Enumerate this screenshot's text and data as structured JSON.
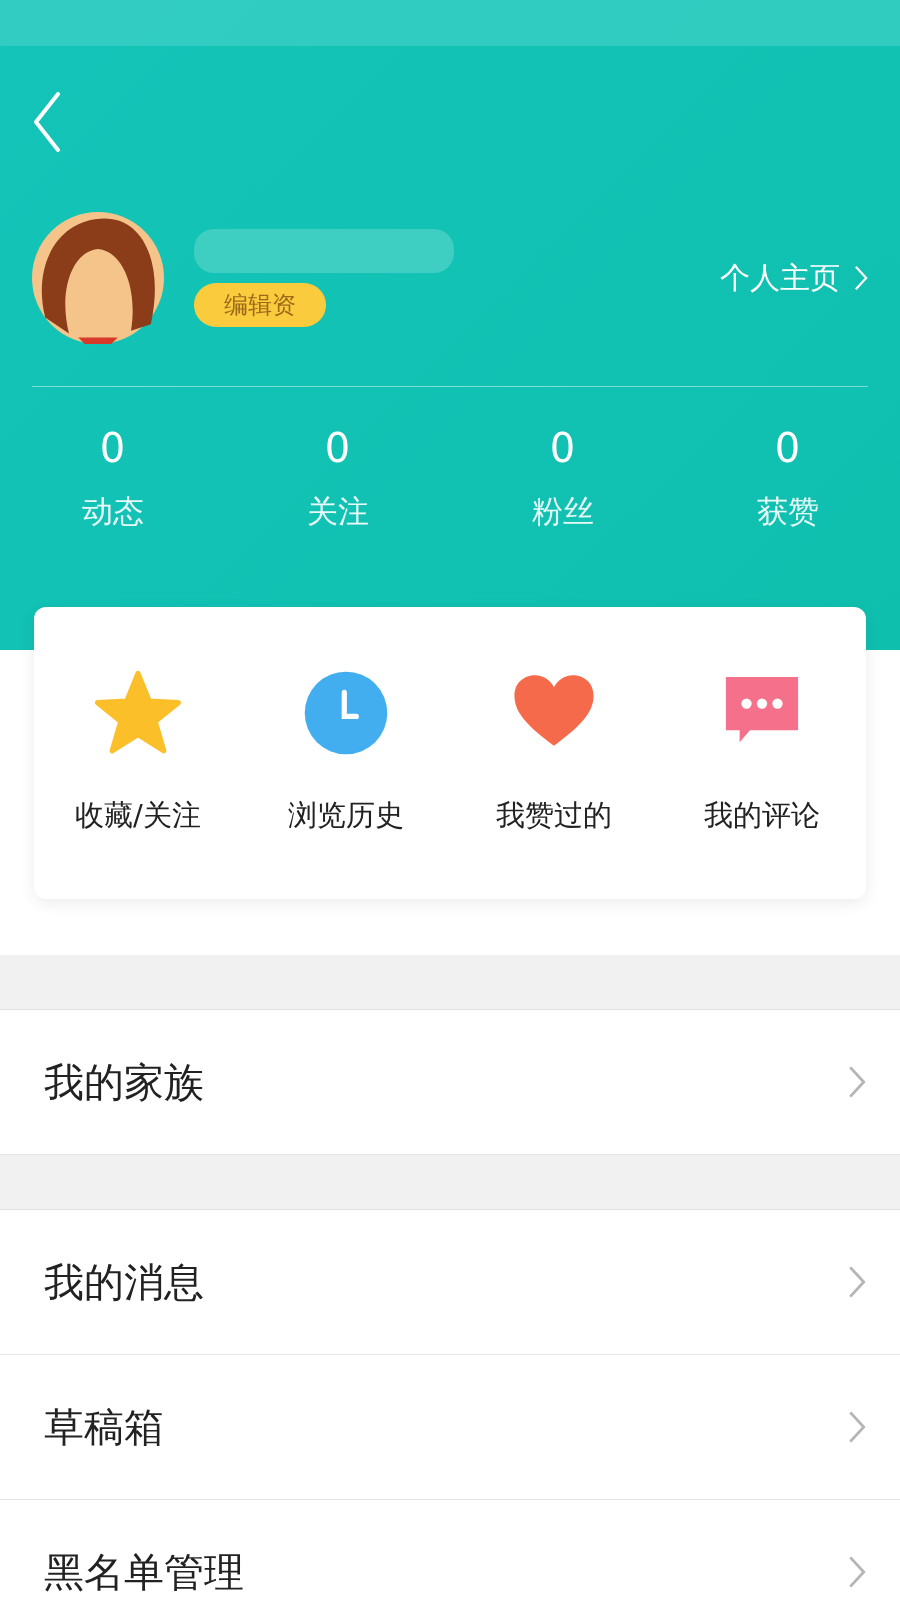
{
  "header": {
    "edit_profile": "编辑资",
    "homepage_link": "个人主页"
  },
  "stats": [
    {
      "value": "0",
      "label": "动态"
    },
    {
      "value": "0",
      "label": "关注"
    },
    {
      "value": "0",
      "label": "粉丝"
    },
    {
      "value": "0",
      "label": "获赞"
    }
  ],
  "shortcuts": [
    {
      "kind": "star",
      "label": "收藏/关注"
    },
    {
      "kind": "clock",
      "label": "浏览历史"
    },
    {
      "kind": "heart",
      "label": "我赞过的"
    },
    {
      "kind": "comment",
      "label": "我的评论"
    }
  ],
  "menu_groups": [
    [
      {
        "label": "我的家族"
      }
    ],
    [
      {
        "label": "我的消息"
      },
      {
        "label": "草稿箱"
      },
      {
        "label": "黑名单管理"
      }
    ]
  ]
}
